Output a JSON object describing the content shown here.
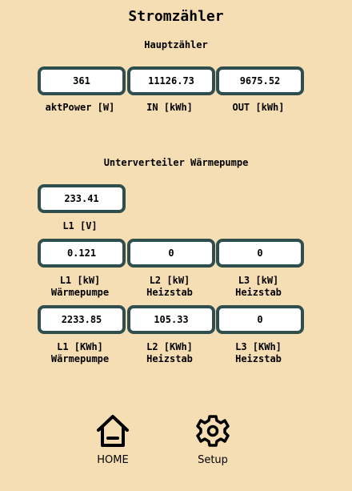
{
  "title": "Stromzähler",
  "main_meter": {
    "heading": "Hauptzähler",
    "fields": [
      {
        "value": "361",
        "label": "aktPower [W]"
      },
      {
        "value": "11126.73",
        "label": "IN [kWh]"
      },
      {
        "value": "9675.52",
        "label": "OUT [kWh]"
      }
    ]
  },
  "sub_meter": {
    "heading": "Unterverteiler Wärmepumpe",
    "voltage": {
      "value": "233.41",
      "label": "L1 [V]"
    },
    "power": [
      {
        "value": "0.121",
        "label1": "L1 [kW]",
        "label2": "Wärmepumpe"
      },
      {
        "value": "0",
        "label1": "L2 [kW]",
        "label2": "Heizstab"
      },
      {
        "value": "0",
        "label1": "L3 [kW]",
        "label2": "Heizstab"
      }
    ],
    "energy": [
      {
        "value": "2233.85",
        "label1": "L1 [KWh]",
        "label2": "Wärmepumpe"
      },
      {
        "value": "105.33",
        "label1": "L2 [KWh]",
        "label2": "Heizstab"
      },
      {
        "value": "0",
        "label1": "L3 [KWh]",
        "label2": "Heizstab"
      }
    ]
  },
  "nav": {
    "home_label": "HOME",
    "setup_label": "Setup",
    "home_icon": "home-icon",
    "setup_icon": "gear-icon"
  },
  "colors": {
    "background": "#f5deb3",
    "box_border": "#2f4f4f",
    "box_fill": "#ffffff"
  }
}
